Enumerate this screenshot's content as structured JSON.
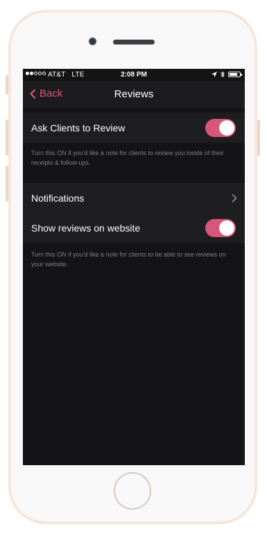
{
  "colors": {
    "accent": "#d9567b",
    "screen_bg": "#141416",
    "row_bg": "#1e1e21"
  },
  "status_bar": {
    "carrier": "AT&T",
    "network": "LTE",
    "time": "2:08 PM",
    "battery_level": 0.75,
    "signal_bars_filled": 2,
    "signal_bars_total": 5
  },
  "nav": {
    "back_label": "Back",
    "title": "Reviews"
  },
  "settings": {
    "ask_clients": {
      "label": "Ask Clients to Review",
      "enabled": true,
      "note": "Turn this ON if you'd like a note for clients to review you inside of their receipts & follow-ups."
    },
    "notifications": {
      "label": "Notifications"
    },
    "show_reviews": {
      "label": "Show reviews on website",
      "enabled": true,
      "note": "Turn this ON if you'd like a note for clients to be able to see reviews on your website."
    }
  }
}
